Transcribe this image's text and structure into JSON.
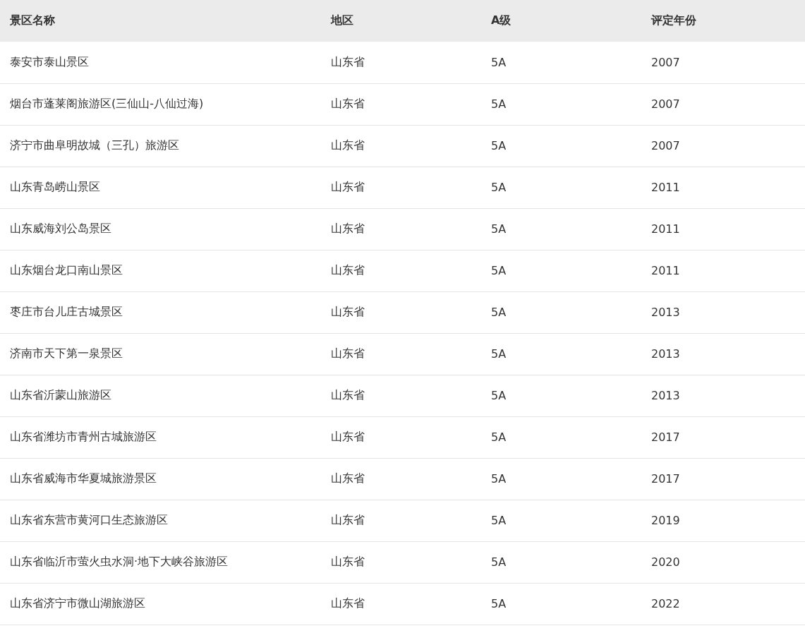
{
  "table": {
    "columns": [
      "景区名称",
      "地区",
      "A级",
      "评定年份"
    ],
    "rows": [
      [
        "泰安市泰山景区",
        "山东省",
        "5A",
        "2007"
      ],
      [
        "烟台市蓬莱阁旅游区(三仙山-八仙过海)",
        "山东省",
        "5A",
        "2007"
      ],
      [
        "济宁市曲阜明故城（三孔）旅游区",
        "山东省",
        "5A",
        "2007"
      ],
      [
        "山东青岛崂山景区",
        "山东省",
        "5A",
        "2011"
      ],
      [
        "山东威海刘公岛景区",
        "山东省",
        "5A",
        "2011"
      ],
      [
        "山东烟台龙口南山景区",
        "山东省",
        "5A",
        "2011"
      ],
      [
        "枣庄市台儿庄古城景区",
        "山东省",
        "5A",
        "2013"
      ],
      [
        "济南市天下第一泉景区",
        "山东省",
        "5A",
        "2013"
      ],
      [
        "山东省沂蒙山旅游区",
        "山东省",
        "5A",
        "2013"
      ],
      [
        "山东省潍坊市青州古城旅游区",
        "山东省",
        "5A",
        "2017"
      ],
      [
        "山东省威海市华夏城旅游景区",
        "山东省",
        "5A",
        "2017"
      ],
      [
        "山东省东营市黄河口生态旅游区",
        "山东省",
        "5A",
        "2019"
      ],
      [
        "山东省临沂市萤火虫水洞·地下大峡谷旅游区",
        "山东省",
        "5A",
        "2020"
      ],
      [
        "山东省济宁市微山湖旅游区",
        "山东省",
        "5A",
        "2022"
      ]
    ]
  }
}
